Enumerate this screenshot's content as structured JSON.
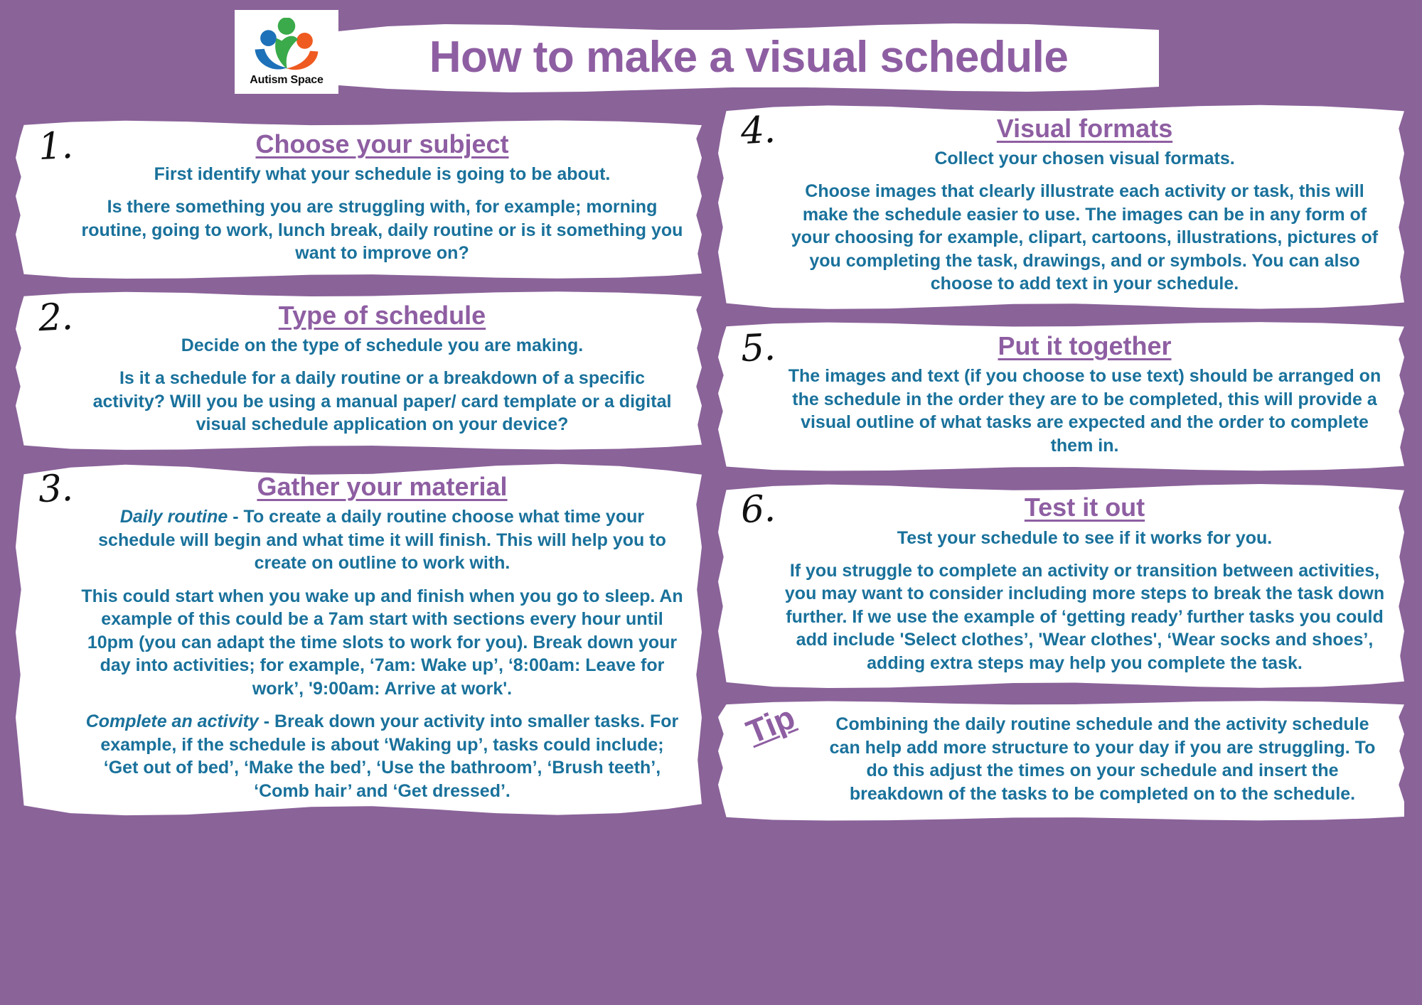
{
  "page": {
    "background_color": "#8a6399",
    "heading_color": "#8e5ea2",
    "body_color": "#19719b",
    "card_color": "#ffffff"
  },
  "header": {
    "title": "How to make a visual schedule",
    "logo": {
      "caption": "Autism Space",
      "icon": "three-people-logo",
      "colors": {
        "green": "#3aaa4a",
        "blue": "#1d71b8",
        "orange": "#ef5a20"
      }
    }
  },
  "left_column": {
    "cards": [
      {
        "number": "1.",
        "heading": "Choose your subject",
        "sub": "First identify what your schedule is going to be about.",
        "paragraphs": [
          "Is there something you are struggling with, for example; morning routine, going to work, lunch break, daily routine or is it something you want to improve on?"
        ]
      },
      {
        "number": "2.",
        "heading": "Type of schedule",
        "sub": "Decide on the type of schedule you are making.",
        "paragraphs": [
          "Is it a schedule for a daily routine or a breakdown of a specific activity? Will you be using a manual paper/ card template or a digital visual schedule application on your device?"
        ]
      },
      {
        "number": "3.",
        "heading": "Gather your material ",
        "sub": "",
        "paragraphs": [
          "This could start when you wake up and finish when you go to sleep. An example of this could be a 7am start with sections every hour until 10pm (you can adapt the time slots to work for you). Break down your day into activities; for example, ‘7am: Wake up’, ‘8:00am: Leave for work’, '9:00am: Arrive at work'."
        ],
        "lead_paragraphs": [
          {
            "term": "Daily routine",
            "text": " - To create a daily routine choose what time your schedule will begin and what time it will finish. This will help you to create on outline to work with."
          },
          {
            "term": "Complete an activity",
            "text": " - Break down your activity into smaller tasks. For example, if the schedule is about ‘Waking up’, tasks could include; ‘Get out of bed’, ‘Make the bed’, ‘Use the bathroom’, ‘Brush teeth’, ‘Comb hair’ and ‘Get dressed’."
          }
        ]
      }
    ]
  },
  "right_column": {
    "cards": [
      {
        "number": "4.",
        "heading": "Visual formats",
        "sub": "Collect your chosen visual formats.",
        "paragraphs": [
          "Choose images that clearly illustrate each activity or task, this will make the schedule easier to use. The images can be in any form of your choosing for example, clipart, cartoons, illustrations, pictures of you completing the task, drawings, and or symbols. You can also choose to add text in your schedule."
        ]
      },
      {
        "number": "5.",
        "heading": "Put it together",
        "sub": "",
        "paragraphs": [
          "The images and text (if you choose to use text) should be arranged on the schedule in the order they are to be completed, this will provide a visual outline of what tasks are expected and the order to complete them in."
        ]
      },
      {
        "number": "6.",
        "heading": "Test it out",
        "sub": "Test your schedule to see if it works for you.",
        "paragraphs": [
          "If you struggle to complete an activity or transition between activities, you may want to consider including more steps to break the task down further. If we use the example of ‘getting ready’ further tasks you could add include 'Select clothes’, 'Wear clothes', ‘Wear socks and shoes’, adding extra steps may help you complete the task."
        ]
      }
    ],
    "tip": {
      "label": "Tip",
      "text": "Combining the daily routine schedule and the activity schedule can help add more structure to your day if you are struggling. To do this adjust the times on your schedule and insert the breakdown of the tasks to be completed on to the schedule."
    }
  }
}
